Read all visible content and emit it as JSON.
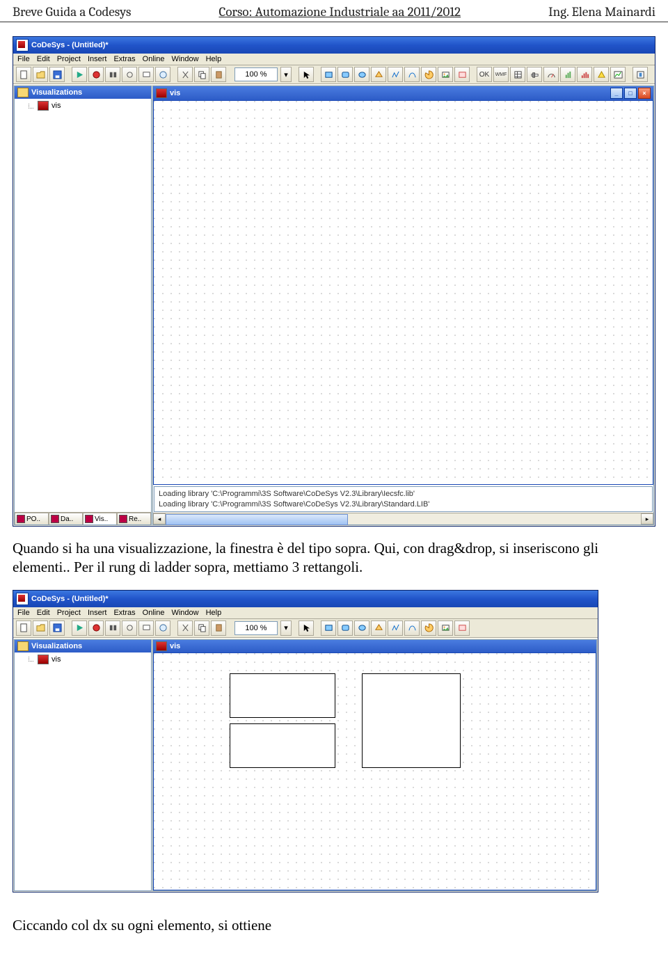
{
  "header": {
    "left": "Breve Guida a Codesys",
    "center": "Corso: Automazione Industriale aa 2011/2012",
    "right": "Ing. Elena Mainardi"
  },
  "app": {
    "title": "CoDeSys - (Untitled)*",
    "menu": [
      "File",
      "Edit",
      "Project",
      "Insert",
      "Extras",
      "Online",
      "Window",
      "Help"
    ],
    "zoom": "100 %",
    "sidebar": {
      "title": "Visualizations",
      "item": "vis",
      "tabs": [
        "PO..",
        "Da..",
        "Vis..",
        "Re.."
      ]
    },
    "inner_title": "vis",
    "log_line1": "Loading library 'C:\\Programmi\\3S Software\\CoDeSys V2.3\\Library\\Iecsfc.lib'",
    "log_line2": "Loading library 'C:\\Programmi\\3S Software\\CoDeSys V2.3\\Library\\Standard.LIB'"
  },
  "para1": "Quando si ha una visualizzazione, la finestra è del tipo sopra. Qui, con drag&drop, si inseriscono gli elementi.. Per il rung di ladder sopra, mettiamo 3 rettangoli.",
  "para2": "Ciccando col dx su ogni elemento, si ottiene"
}
